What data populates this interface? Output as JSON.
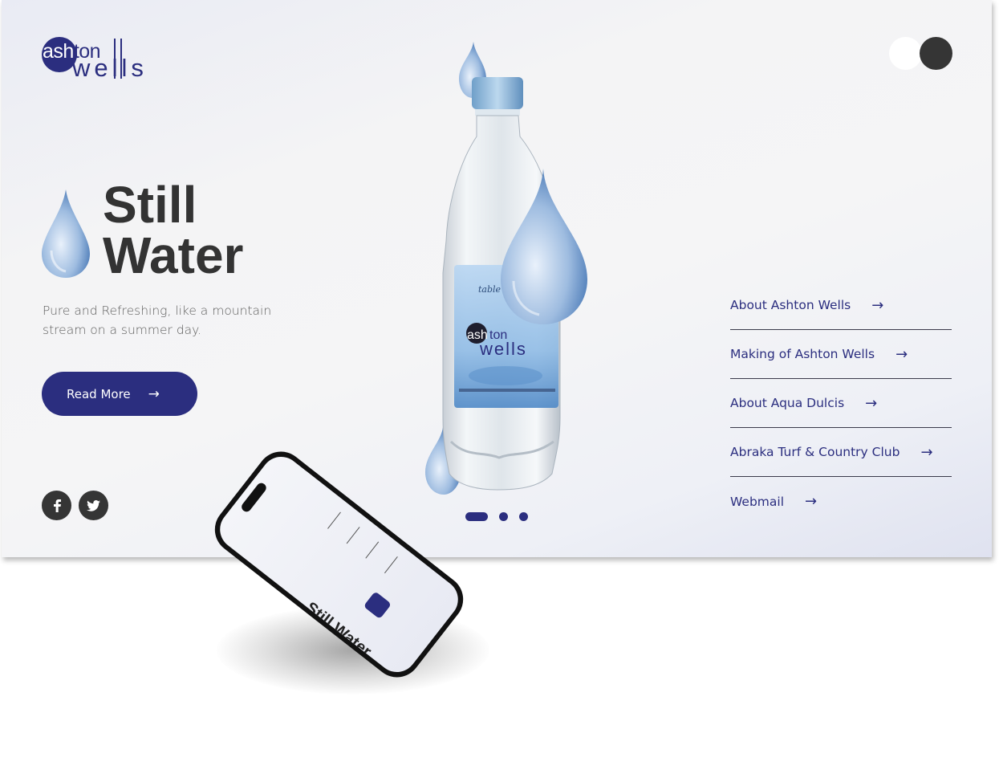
{
  "brand": {
    "logo_top": "ashton",
    "logo_bottom": "wells",
    "primary_color": "#2b2e7f",
    "dark_color": "#353535"
  },
  "theme_toggle": {
    "light_icon": "light-mode-circle-icon",
    "dark_icon": "dark-mode-circle-icon"
  },
  "hero": {
    "title_line1": "Still",
    "title_line2": "Water",
    "subtitle": "Pure and Refreshing, like a mountain stream on a summer day.",
    "cta_label": "Read More",
    "cta_arrow": "→"
  },
  "social": [
    {
      "name": "facebook-icon",
      "glyph": "f"
    },
    {
      "name": "twitter-icon",
      "glyph": "twitter"
    }
  ],
  "carousel": {
    "slides": 3,
    "active": 1
  },
  "nav": {
    "arrow": "→",
    "items": [
      {
        "label": "About Ashton Wells"
      },
      {
        "label": "Making of Ashton Wells"
      },
      {
        "label": "About Aqua Dulcis"
      },
      {
        "label": "Abraka Turf & Country Club"
      },
      {
        "label": "Webmail"
      }
    ]
  },
  "mockup": {
    "title_line1": "Still",
    "title_line2": "Water"
  }
}
